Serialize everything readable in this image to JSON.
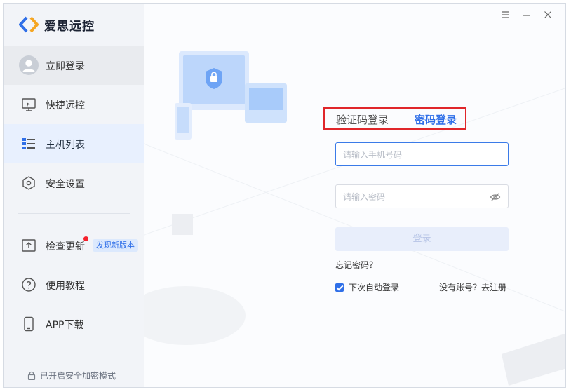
{
  "app": {
    "name": "爱思远控",
    "accent": "#2f6fe8",
    "logo_colors": [
      "#2f6fe8",
      "#f5a623"
    ]
  },
  "sidebar": {
    "items": [
      {
        "label": "立即登录",
        "icon": "avatar-icon"
      },
      {
        "label": "快捷远控",
        "icon": "monitor-icon"
      },
      {
        "label": "主机列表",
        "icon": "list-icon"
      },
      {
        "label": "安全设置",
        "icon": "hexagon-icon"
      },
      {
        "label": "检查更新",
        "icon": "upload-icon"
      },
      {
        "label": "使用教程",
        "icon": "question-circle-icon"
      },
      {
        "label": "APP下载",
        "icon": "phone-icon"
      }
    ],
    "update_badge": "发现新版本",
    "security_note": "已开启安全加密模式"
  },
  "login": {
    "tab_sms": "验证码登录",
    "tab_password": "密码登录",
    "phone_placeholder": "请输入手机号码",
    "password_placeholder": "请输入密码",
    "submit": "登录",
    "forgot": "忘记密码？",
    "auto_login": "下次自动登录",
    "register": "没有账号？去注册"
  },
  "window_controls": [
    "menu-icon",
    "minimize-icon",
    "close-icon"
  ]
}
